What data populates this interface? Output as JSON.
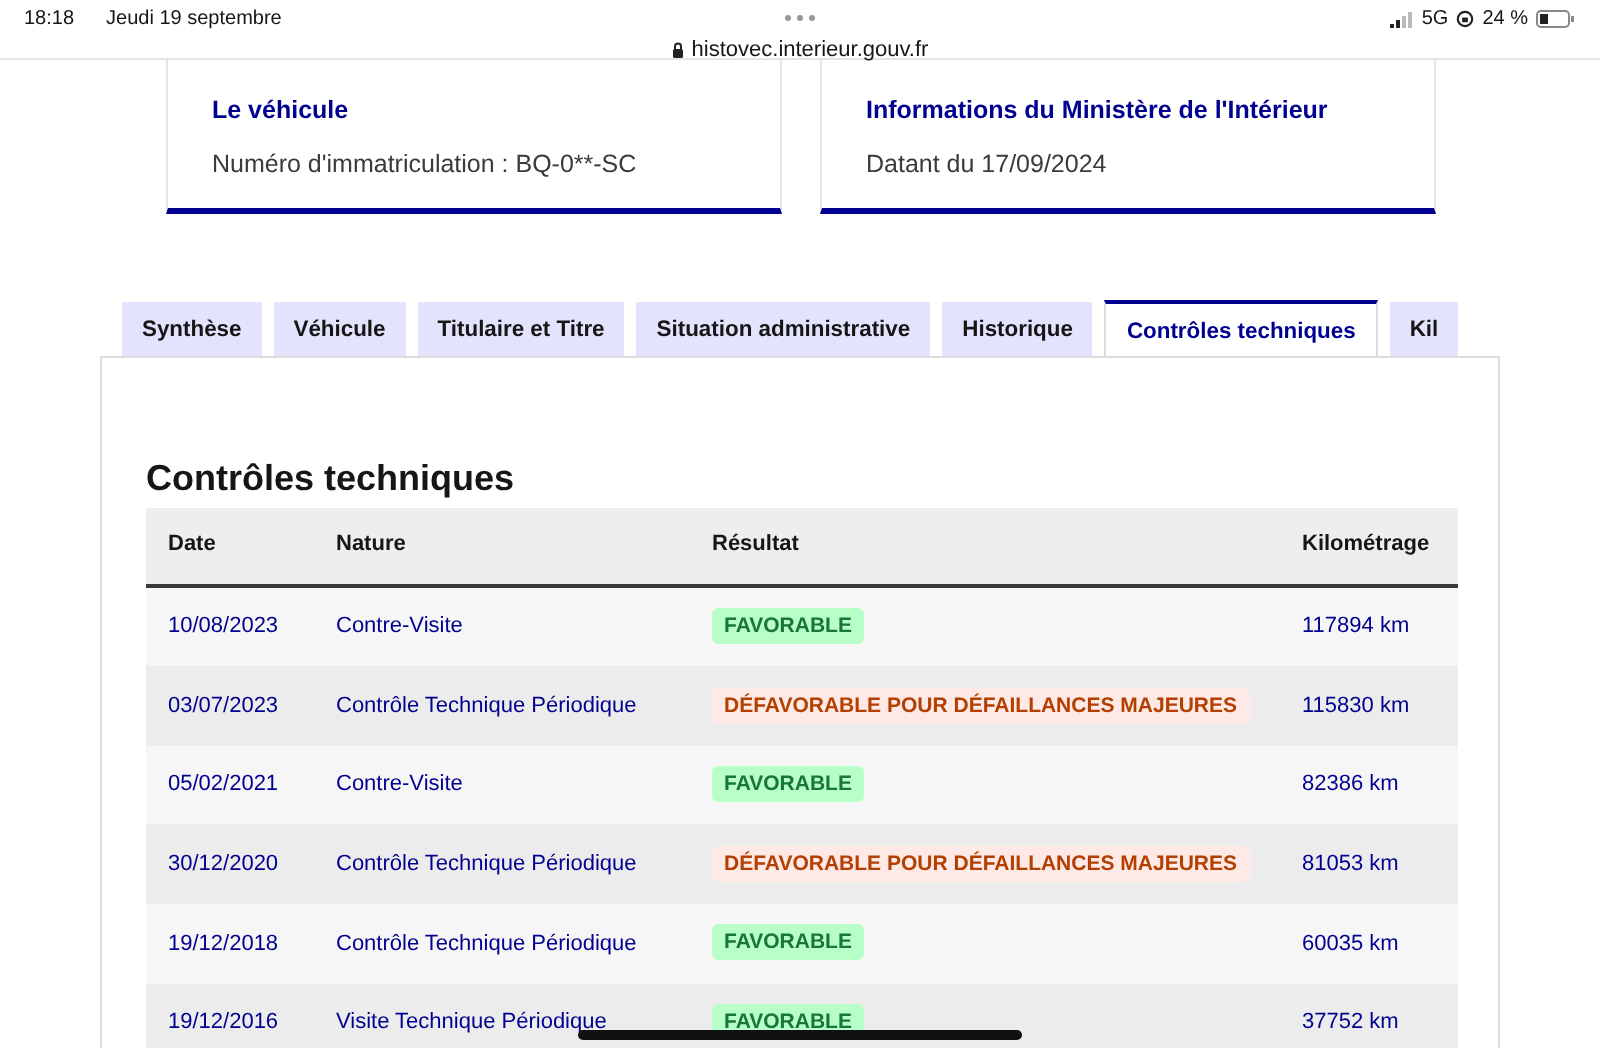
{
  "status_bar": {
    "time": "18:18",
    "date": "Jeudi 19 septembre",
    "url": "histovec.interieur.gouv.fr",
    "network": "5G",
    "battery": "24 %"
  },
  "cards": [
    {
      "title": "Le véhicule",
      "text": "Numéro d'immatriculation : BQ-0**-SC"
    },
    {
      "title": "Informations du Ministère de l'Intérieur",
      "text": "Datant du 17/09/2024"
    }
  ],
  "tabs": [
    {
      "label": "Synthèse",
      "selected": false
    },
    {
      "label": "Véhicule",
      "selected": false
    },
    {
      "label": "Titulaire et Titre",
      "selected": false
    },
    {
      "label": "Situation administrative",
      "selected": false
    },
    {
      "label": "Historique",
      "selected": false
    },
    {
      "label": "Contrôles techniques",
      "selected": true
    },
    {
      "label": "Kil",
      "selected": false
    }
  ],
  "section_title": "Contrôles techniques",
  "table": {
    "columns": [
      "Date",
      "Nature",
      "Résultat",
      "Kilométrage"
    ],
    "rows": [
      {
        "date": "10/08/2023",
        "nature": "Contre-Visite",
        "result": {
          "text": "FAVORABLE",
          "kind": "success"
        },
        "mileage": "117894 km"
      },
      {
        "date": "03/07/2023",
        "nature": "Contrôle Technique Périodique",
        "result": {
          "text": "DÉFAVORABLE POUR DÉFAILLANCES MAJEURES",
          "kind": "error"
        },
        "mileage": "115830 km"
      },
      {
        "date": "05/02/2021",
        "nature": "Contre-Visite",
        "result": {
          "text": "FAVORABLE",
          "kind": "success"
        },
        "mileage": "82386 km"
      },
      {
        "date": "30/12/2020",
        "nature": "Contrôle Technique Périodique",
        "result": {
          "text": "DÉFAVORABLE POUR DÉFAILLANCES MAJEURES",
          "kind": "error"
        },
        "mileage": "81053 km"
      },
      {
        "date": "19/12/2018",
        "nature": "Contrôle Technique Périodique",
        "result": {
          "text": "FAVORABLE",
          "kind": "success"
        },
        "mileage": "60035 km"
      },
      {
        "date": "19/12/2016",
        "nature": "Visite Technique Périodique",
        "result": {
          "text": "FAVORABLE",
          "kind": "success"
        },
        "mileage": "37752 km"
      }
    ]
  }
}
